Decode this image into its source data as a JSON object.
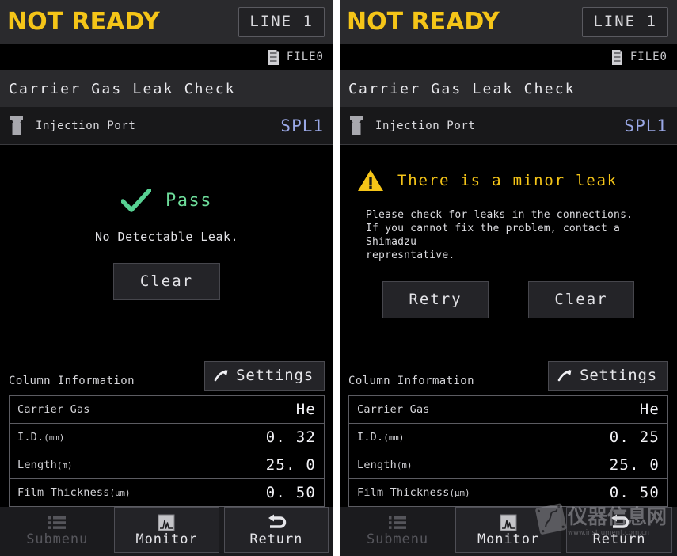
{
  "panels": [
    {
      "status": "NOT READY",
      "line_button": "LINE 1",
      "file_label": "FILE0",
      "file_icon": "document-icon",
      "screen_title": "Carrier Gas Leak Check",
      "port": {
        "icon": "injection-port-icon",
        "label": "Injection Port",
        "value": "SPL1"
      },
      "result": {
        "kind": "pass",
        "icon": "check-icon",
        "headline": "Pass",
        "detail": "No Detectable Leak.",
        "buttons": [
          "Clear"
        ]
      },
      "column_info": {
        "title": "Column Information",
        "settings_button": "Settings",
        "settings_icon": "arrow-up-right-icon",
        "rows": [
          {
            "label": "Carrier Gas",
            "unit": "",
            "value": "He"
          },
          {
            "label": "I.D.",
            "unit": "(mm)",
            "value": "0. 32"
          },
          {
            "label": "Length",
            "unit": "(m)",
            "value": "25. 0"
          },
          {
            "label": "Film Thickness",
            "unit": "(µm)",
            "value": "0. 50"
          }
        ]
      },
      "nav": [
        {
          "label": "Submenu",
          "icon": "list-icon",
          "enabled": false
        },
        {
          "label": "Monitor",
          "icon": "chromatogram-icon",
          "enabled": true
        },
        {
          "label": "Return",
          "icon": "return-arrow-icon",
          "enabled": true
        }
      ]
    },
    {
      "status": "NOT READY",
      "line_button": "LINE 1",
      "file_label": "FILE0",
      "file_icon": "document-icon",
      "screen_title": "Carrier Gas Leak Check",
      "port": {
        "icon": "injection-port-icon",
        "label": "Injection Port",
        "value": "SPL1"
      },
      "result": {
        "kind": "warn",
        "icon": "warning-triangle-icon",
        "headline": "There is a minor leak",
        "detail": "Please check for leaks in the connections.\nIf you cannot fix the problem, contact a Shimadzu\nrepresntative.",
        "buttons": [
          "Retry",
          "Clear"
        ]
      },
      "column_info": {
        "title": "Column Information",
        "settings_button": "Settings",
        "settings_icon": "arrow-up-right-icon",
        "rows": [
          {
            "label": "Carrier Gas",
            "unit": "",
            "value": "He"
          },
          {
            "label": "I.D.",
            "unit": "(mm)",
            "value": "0. 25"
          },
          {
            "label": "Length",
            "unit": "(m)",
            "value": "25. 0"
          },
          {
            "label": "Film Thickness",
            "unit": "(µm)",
            "value": "0. 50"
          }
        ]
      },
      "nav": [
        {
          "label": "Submenu",
          "icon": "list-icon",
          "enabled": false
        },
        {
          "label": "Monitor",
          "icon": "chromatogram-icon",
          "enabled": true
        },
        {
          "label": "Return",
          "icon": "return-arrow-icon",
          "enabled": true
        }
      ],
      "watermark": {
        "text": "仪器信息网",
        "url": "www.instrument.com.cn"
      }
    }
  ],
  "colors": {
    "status_yellow": "#f5c518",
    "pass_green": "#6ddc9a",
    "port_value_blue": "#9aa8e6",
    "panel_bg": "#000000",
    "header_bg": "#2a2a2d"
  }
}
